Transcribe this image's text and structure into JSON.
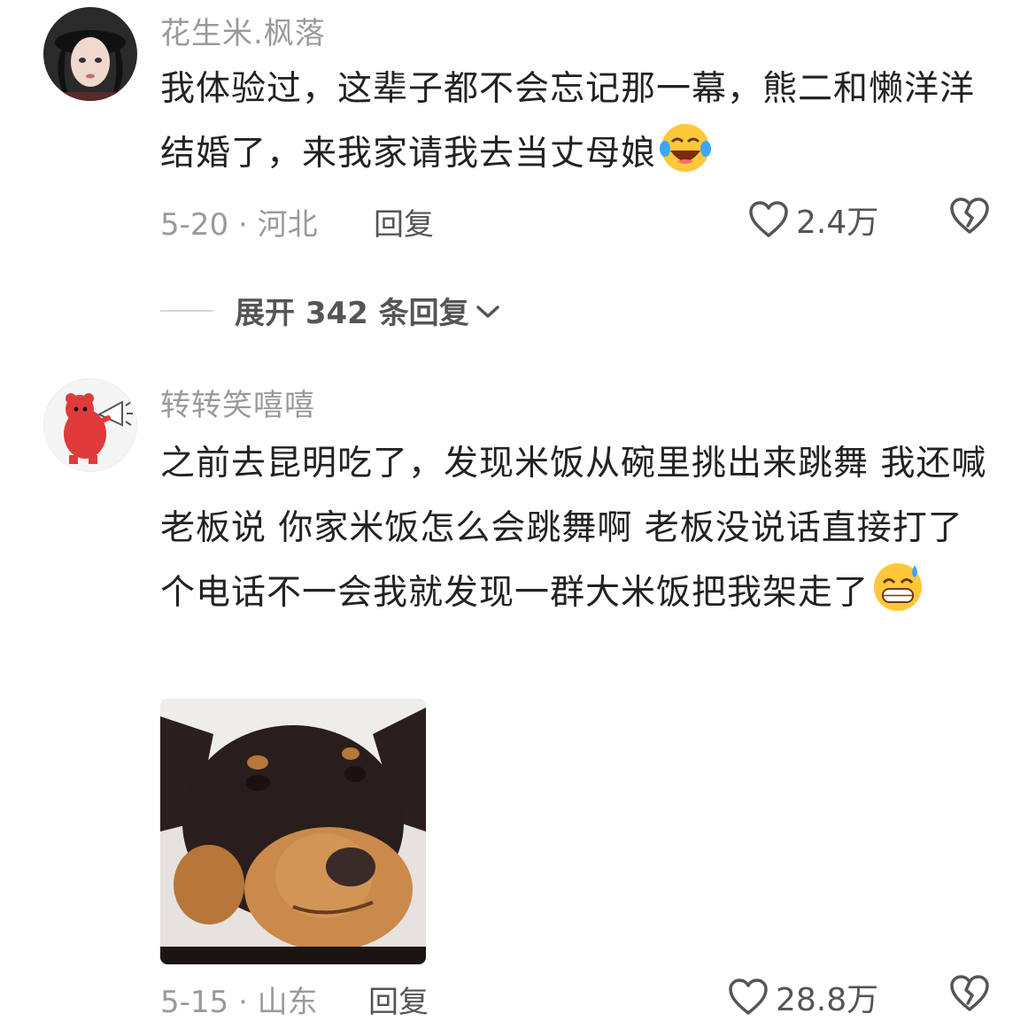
{
  "comments": [
    {
      "username": "花生米.枫落",
      "text": "我体验过，这辈子都不会忘记那一幕，熊二和懒洋洋结婚了，来我家请我去当丈母娘",
      "emoji": "laughing-tears",
      "date": "5-20",
      "location": "河北",
      "reply_label": "回复",
      "likes": "2.4万"
    },
    {
      "username": "转转笑嘻嘻",
      "text": "之前去昆明吃了，发现米饭从碗里挑出来跳舞 我还喊老板说 你家米饭怎么会跳舞啊   老板没说话直接打了个电话不一会我就发现一群大米饭把我架走了",
      "emoji": "grinning-sweat",
      "date": "5-15",
      "location": "山东",
      "reply_label": "回复",
      "likes": "28.8万"
    }
  ],
  "expand_replies": {
    "label": "展开 342 条回复"
  },
  "icons": [
    "heart-icon",
    "broken-heart-icon",
    "chevron-down-icon"
  ],
  "colors": {
    "muted": "#9a9a9a",
    "text": "#222222",
    "secondary": "#555555"
  }
}
